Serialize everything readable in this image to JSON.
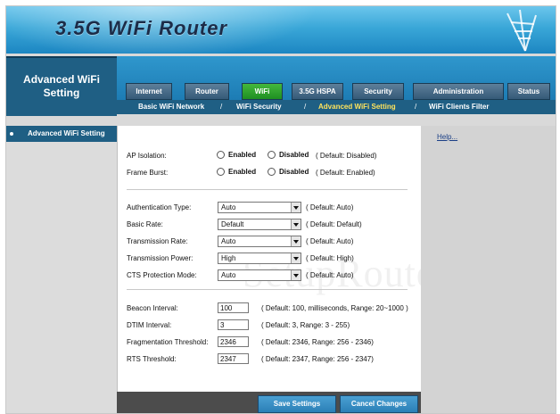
{
  "header": {
    "title": "3.5G WiFi Router"
  },
  "left_title": {
    "line1": "Advanced WiFi",
    "line2": "Setting"
  },
  "nav": {
    "tabs": [
      {
        "label": "Internet"
      },
      {
        "label": "Router"
      },
      {
        "label": "WiFi"
      },
      {
        "label": "3.5G HSPA"
      },
      {
        "label": "Security"
      },
      {
        "label": "Administration"
      },
      {
        "label": "Status"
      }
    ],
    "subnav": [
      {
        "label": "Basic WiFi Network"
      },
      {
        "label": "WiFi Security"
      },
      {
        "label": "Advanced WiFi Setting"
      },
      {
        "label": "WiFi Clients Filter"
      }
    ]
  },
  "sidebar": {
    "item": "Advanced WiFi Setting"
  },
  "help": {
    "link": "Help..."
  },
  "form": {
    "ap_isolation": {
      "label": "AP Isolation:",
      "opt1": "Enabled",
      "opt2": "Disabled",
      "default": "( Default: Disabled)"
    },
    "frame_burst": {
      "label": "Frame Burst:",
      "opt1": "Enabled",
      "opt2": "Disabled",
      "default": "( Default: Enabled)"
    },
    "auth_type": {
      "label": "Authentication Type:",
      "value": "Auto",
      "default": "( Default: Auto)"
    },
    "basic_rate": {
      "label": "Basic Rate:",
      "value": "Default",
      "default": "( Default: Default)"
    },
    "tx_rate": {
      "label": "Transmission Rate:",
      "value": "Auto",
      "default": "( Default: Auto)"
    },
    "tx_power": {
      "label": "Transmission Power:",
      "value": "High",
      "default": "( Default: High)"
    },
    "cts_mode": {
      "label": "CTS Protection Mode:",
      "value": "Auto",
      "default": "( Default: Auto)"
    },
    "beacon": {
      "label": "Beacon Interval:",
      "value": "100",
      "default": "( Default: 100, milliseconds, Range: 20~1000 )"
    },
    "dtim": {
      "label": "DTIM Interval:",
      "value": "3",
      "default": "( Default: 3, Range: 3 - 255)"
    },
    "frag": {
      "label": "Fragmentation Threshold:",
      "value": "2346",
      "default": "( Default: 2346, Range: 256 - 2346)"
    },
    "rts": {
      "label": "RTS Threshold:",
      "value": "2347",
      "default": "( Default: 2347, Range: 256 - 2347)"
    }
  },
  "buttons": {
    "save": "Save Settings",
    "cancel": "Cancel Changes"
  },
  "watermark": "SetupRouter.com"
}
